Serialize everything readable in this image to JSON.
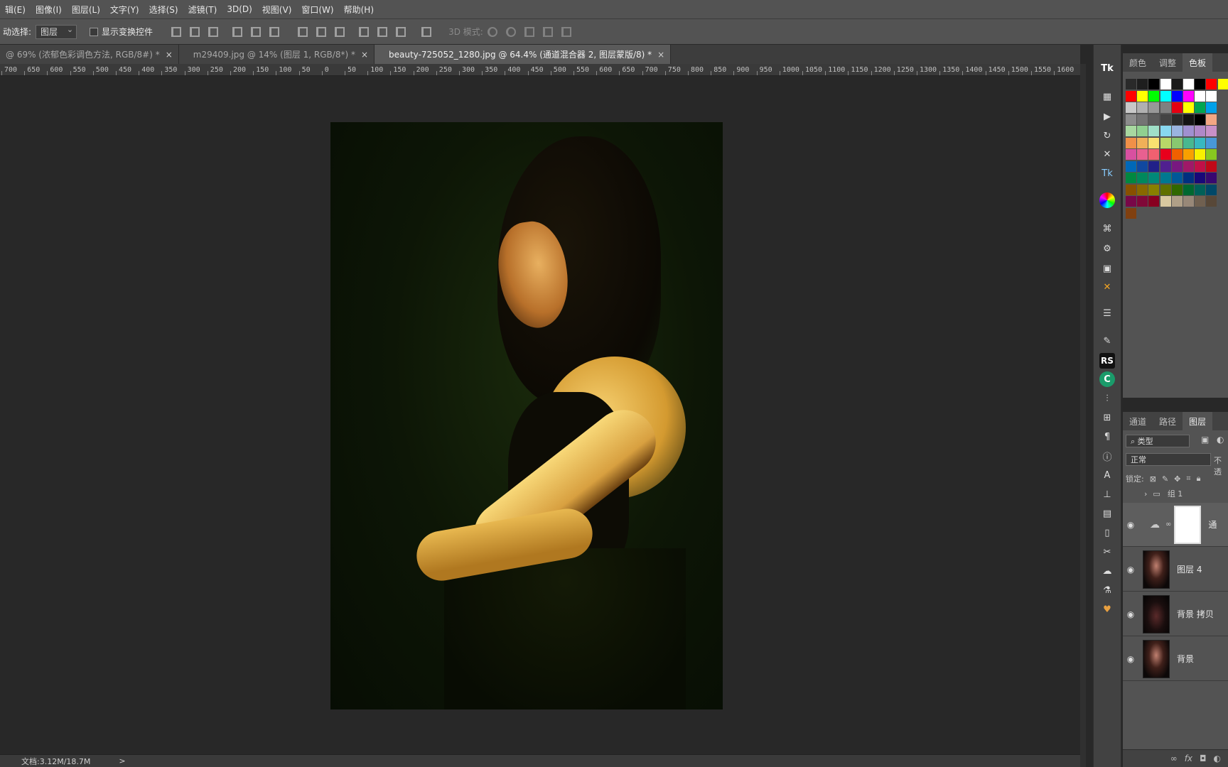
{
  "menubar": {
    "items": [
      "辑(E)",
      "图像(I)",
      "图层(L)",
      "文字(Y)",
      "选择(S)",
      "滤镜(T)",
      "3D(D)",
      "视图(V)",
      "窗口(W)",
      "帮助(H)"
    ]
  },
  "options": {
    "auto_select_label": "动选择:",
    "auto_select_value": "图层",
    "show_transform_label": "显示变换控件",
    "mode_3d_label": "3D 模式:"
  },
  "tabs": [
    {
      "label": "@ 69% (浓郁色彩调色方法, RGB/8#) *",
      "close": "×",
      "active": false
    },
    {
      "label": "m29409.jpg @ 14% (图层 1, RGB/8*) *",
      "close": "×",
      "active": false
    },
    {
      "label": "beauty-725052_1280.jpg @ 64.4% (通道混合器 2, 图层蒙版/8) *",
      "close": "×",
      "active": true
    }
  ],
  "ruler_labels": [
    "700",
    "650",
    "600",
    "550",
    "500",
    "450",
    "400",
    "350",
    "300",
    "250",
    "200",
    "150",
    "100",
    "50",
    "0",
    "50",
    "100",
    "150",
    "200",
    "250",
    "300",
    "350",
    "400",
    "450",
    "500",
    "550",
    "600",
    "650",
    "700",
    "750",
    "800",
    "850",
    "900",
    "950",
    "1000",
    "1050",
    "1100",
    "1150",
    "1200",
    "1250",
    "1300",
    "1350",
    "1400",
    "1450",
    "1500",
    "1550",
    "1600"
  ],
  "status": {
    "doc_size": "文档:3.12M/18.7M",
    "arrow": ">"
  },
  "collapse": "«",
  "top_panel": {
    "tabs": [
      "颜色",
      "调整",
      "色板"
    ],
    "active_tab": "色板"
  },
  "swatch_colors": [
    [
      "#2a2a2a",
      "#1e1e1e",
      "#000000",
      "#ffffff",
      "#1a1a1a",
      "#ffffff",
      "#000000",
      "#ff0000",
      "#ffff00"
    ],
    [
      "#ff0000",
      "#ffff00",
      "#00ff00",
      "#00ffff",
      "#0000ff",
      "#ff00ff",
      "#ffffff",
      "#ffffff"
    ],
    [
      "#c8c8c8",
      "#b0b0b0",
      "#989898",
      "#808080",
      "#e60012",
      "#ffff00",
      "#00a650",
      "#00a0e9"
    ],
    [
      "#8c8c8c",
      "#747474",
      "#5c5c5c",
      "#444444",
      "#2c2c2c",
      "#141414",
      "#000000",
      "#f3a683"
    ],
    [
      "#a8d8a0",
      "#90d090",
      "#a0e0c8",
      "#88d8f0",
      "#9ab4e0",
      "#a090d0",
      "#b088c8",
      "#c890c8"
    ],
    [
      "#f09048",
      "#f0b058",
      "#f8e070",
      "#b8d868",
      "#88c870",
      "#48b890",
      "#38b8c0",
      "#4898d8"
    ],
    [
      "#d850a0",
      "#e86090",
      "#f06070",
      "#e8001c",
      "#f06000",
      "#f8a000",
      "#f8f000",
      "#88c820"
    ],
    [
      "#0068b8",
      "#1048a0",
      "#202088",
      "#502090",
      "#781880",
      "#a01868",
      "#c01048",
      "#c00818"
    ],
    [
      "#008840",
      "#00885c",
      "#008878",
      "#007890",
      "#005898",
      "#003080",
      "#180878",
      "#380870"
    ],
    [
      "#885000",
      "#886800",
      "#888000",
      "#607000",
      "#306800",
      "#006830",
      "#006058",
      "#004868"
    ],
    [
      "#780848",
      "#800838",
      "#880020",
      "#d8c8a0",
      "#b0a088",
      "#988878",
      "#706050",
      "#584838"
    ],
    [
      "#804010"
    ]
  ],
  "layers_panel": {
    "tabs": [
      "通道",
      "路径",
      "图层"
    ],
    "active_tab": "图层",
    "filter": "类型",
    "blend_mode": "正常",
    "opacity_label": "不透",
    "lock_label": "锁定:",
    "layers": [
      {
        "name": "组 1",
        "type": "group",
        "visible": false
      },
      {
        "name": "通",
        "type": "adjustment",
        "visible": true
      },
      {
        "name": "图层 4",
        "type": "pixel",
        "visible": true
      },
      {
        "name": "背景 拷贝",
        "type": "pixel",
        "visible": true
      },
      {
        "name": "背景",
        "type": "pixel",
        "visible": true
      }
    ]
  },
  "bottom_icons": [
    "link-icon",
    "fx-icon",
    "mask-icon",
    "adjustment-icon"
  ],
  "fx_label": "fx"
}
